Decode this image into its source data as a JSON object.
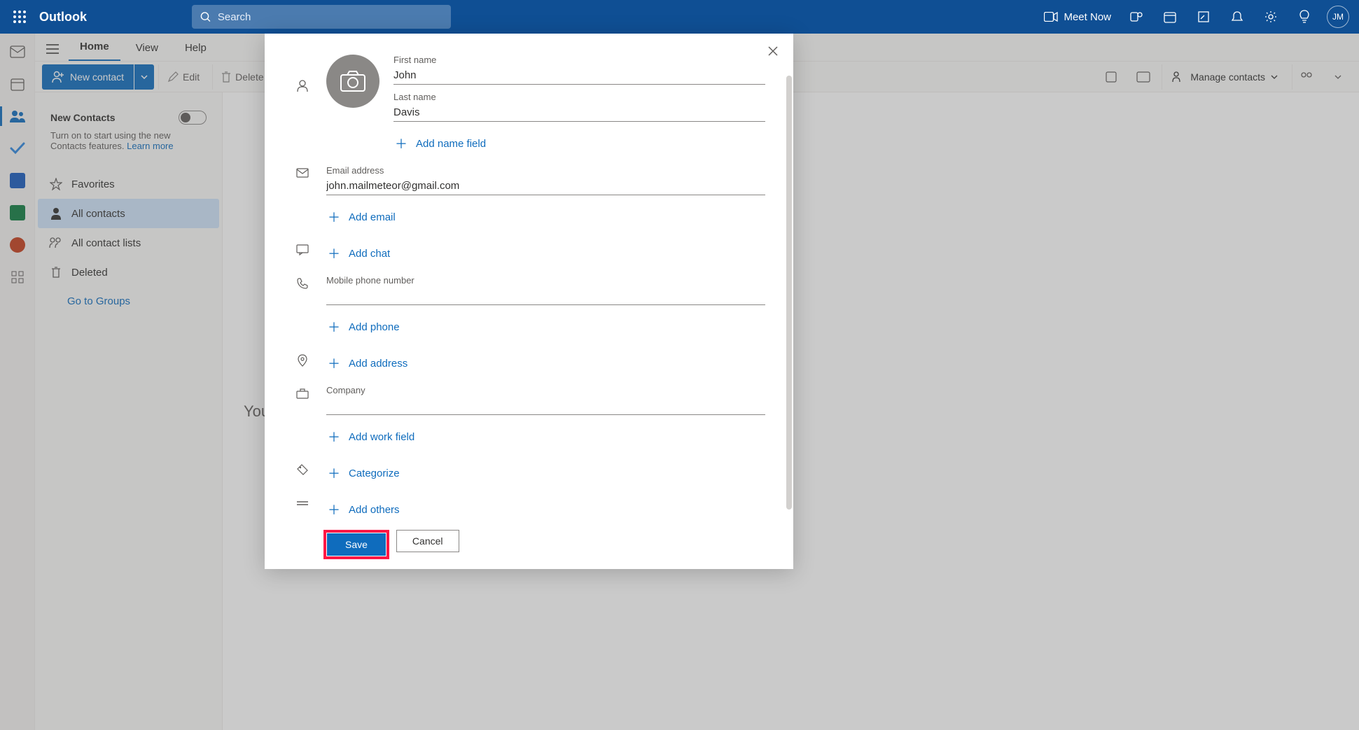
{
  "header": {
    "brand": "Outlook",
    "search_placeholder": "Search",
    "meet_now": "Meet Now",
    "avatar_initials": "JM"
  },
  "tabs": {
    "home": "Home",
    "view": "View",
    "help": "Help"
  },
  "ribbon": {
    "new_contact": "New contact",
    "edit": "Edit",
    "delete": "Delete",
    "manage_contacts": "Manage contacts"
  },
  "left_panel": {
    "promo_title": "New Contacts",
    "promo_desc_prefix": "Turn on to start using the new Contacts features.  ",
    "promo_link": "Learn more",
    "favorites": "Favorites",
    "all_contacts": "All contacts",
    "all_contact_lists": "All contact lists",
    "deleted": "Deleted",
    "go_to_groups": "Go to Groups"
  },
  "center": {
    "empty_heading_visible": "You"
  },
  "modal": {
    "first_name_label": "First name",
    "first_name_value": "John",
    "last_name_label": "Last name",
    "last_name_value": "Davis",
    "add_name_field": "Add name field",
    "email_label": "Email address",
    "email_value": "john.mailmeteor@gmail.com",
    "add_email": "Add email",
    "add_chat": "Add chat",
    "phone_label": "Mobile phone number",
    "phone_value": "",
    "add_phone": "Add phone",
    "add_address": "Add address",
    "company_label": "Company",
    "company_value": "",
    "add_work_field": "Add work field",
    "categorize": "Categorize",
    "add_others": "Add others",
    "save": "Save",
    "cancel": "Cancel"
  }
}
